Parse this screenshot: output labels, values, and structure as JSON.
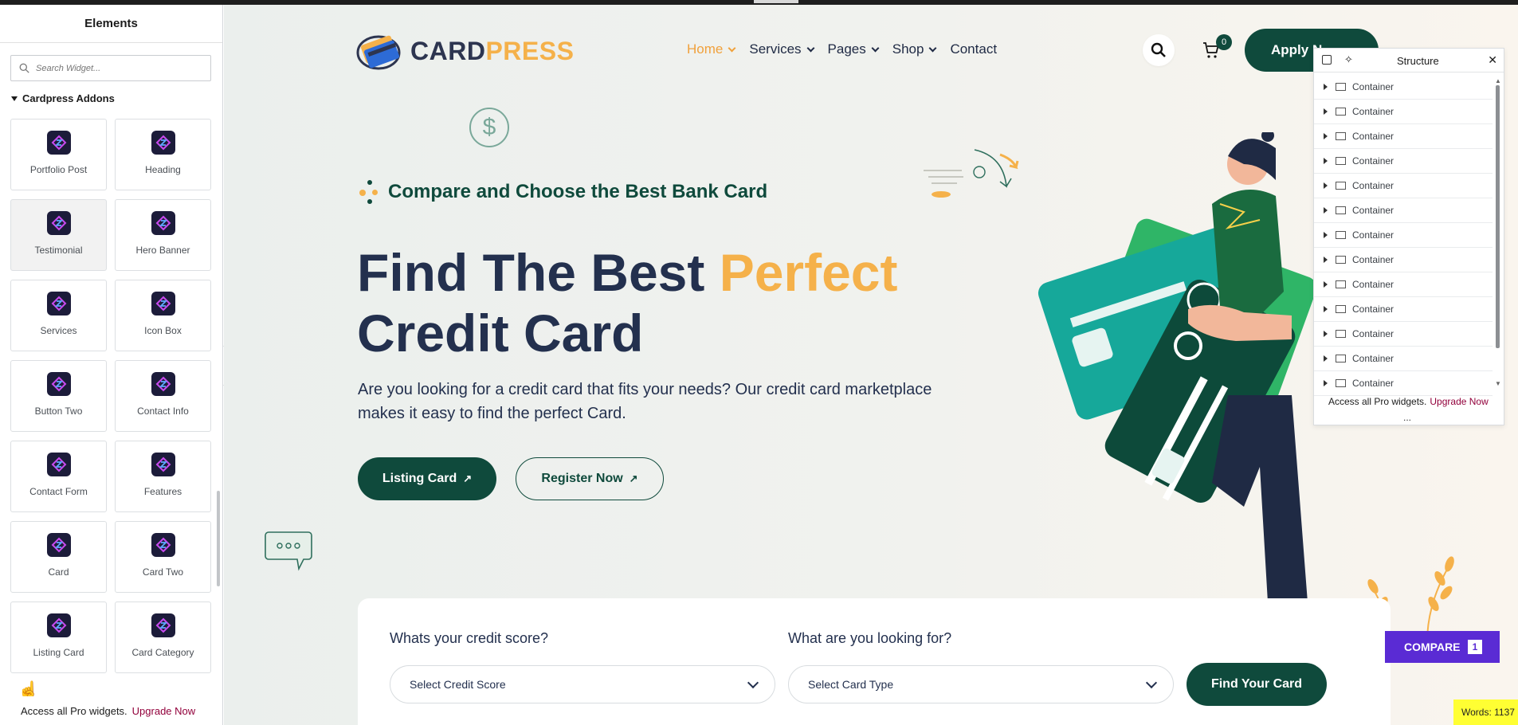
{
  "elements_panel": {
    "title": "Elements",
    "search_placeholder": "Search Widget...",
    "category": "Cardpress Addons",
    "widgets": [
      {
        "label": "Portfolio Post"
      },
      {
        "label": "Heading"
      },
      {
        "label": "Testimonial"
      },
      {
        "label": "Hero Banner"
      },
      {
        "label": "Services"
      },
      {
        "label": "Icon Box"
      },
      {
        "label": "Button Two"
      },
      {
        "label": "Contact Info"
      },
      {
        "label": "Contact Form"
      },
      {
        "label": "Features"
      },
      {
        "label": "Card"
      },
      {
        "label": "Card Two"
      },
      {
        "label": "Listing Card"
      },
      {
        "label": "Card Category"
      }
    ],
    "footer_text": "Access all Pro widgets.",
    "footer_link": "Upgrade Now"
  },
  "site": {
    "brand_part1": "CARD",
    "brand_part2": "PRESS",
    "menu": [
      {
        "label": "Home",
        "has_dropdown": true,
        "active": true
      },
      {
        "label": "Services",
        "has_dropdown": true
      },
      {
        "label": "Pages",
        "has_dropdown": true
      },
      {
        "label": "Shop",
        "has_dropdown": true
      },
      {
        "label": "Contact",
        "has_dropdown": false
      }
    ],
    "cart_count": "0",
    "apply_button": "Apply N"
  },
  "hero": {
    "eyebrow": "Compare and Choose the Best Bank Card",
    "title_line1_a": "Find The Best ",
    "title_line1_b": "Perfect",
    "title_line2": "Credit Card",
    "paragraph": "Are you looking for a credit card that fits your needs? Our credit card marketplace makes it easy to find the perfect Card.",
    "btn_primary": "Listing Card",
    "btn_secondary": "Register Now"
  },
  "finder": {
    "label_score": "Whats your credit score?",
    "label_type": "What are you looking for?",
    "select_score": "Select Credit Score",
    "select_type": "Select Card Type",
    "button": "Find Your Card"
  },
  "compare": {
    "label": "COMPARE",
    "count": "1"
  },
  "word_count": "Words: 1137",
  "structure_panel": {
    "title": "Structure",
    "rows": [
      "Container",
      "Container",
      "Container",
      "Container",
      "Container",
      "Container",
      "Container",
      "Container",
      "Container",
      "Container",
      "Container",
      "Container",
      "Container"
    ],
    "footer_text": "Access all Pro widgets.",
    "footer_link": "Upgrade Now",
    "more": "..."
  },
  "colors": {
    "primary": "#0f4a3c",
    "accent": "#f5b14a",
    "navy": "#23304e",
    "compare": "#5a2bd4",
    "upgrade_link": "#92003b"
  }
}
